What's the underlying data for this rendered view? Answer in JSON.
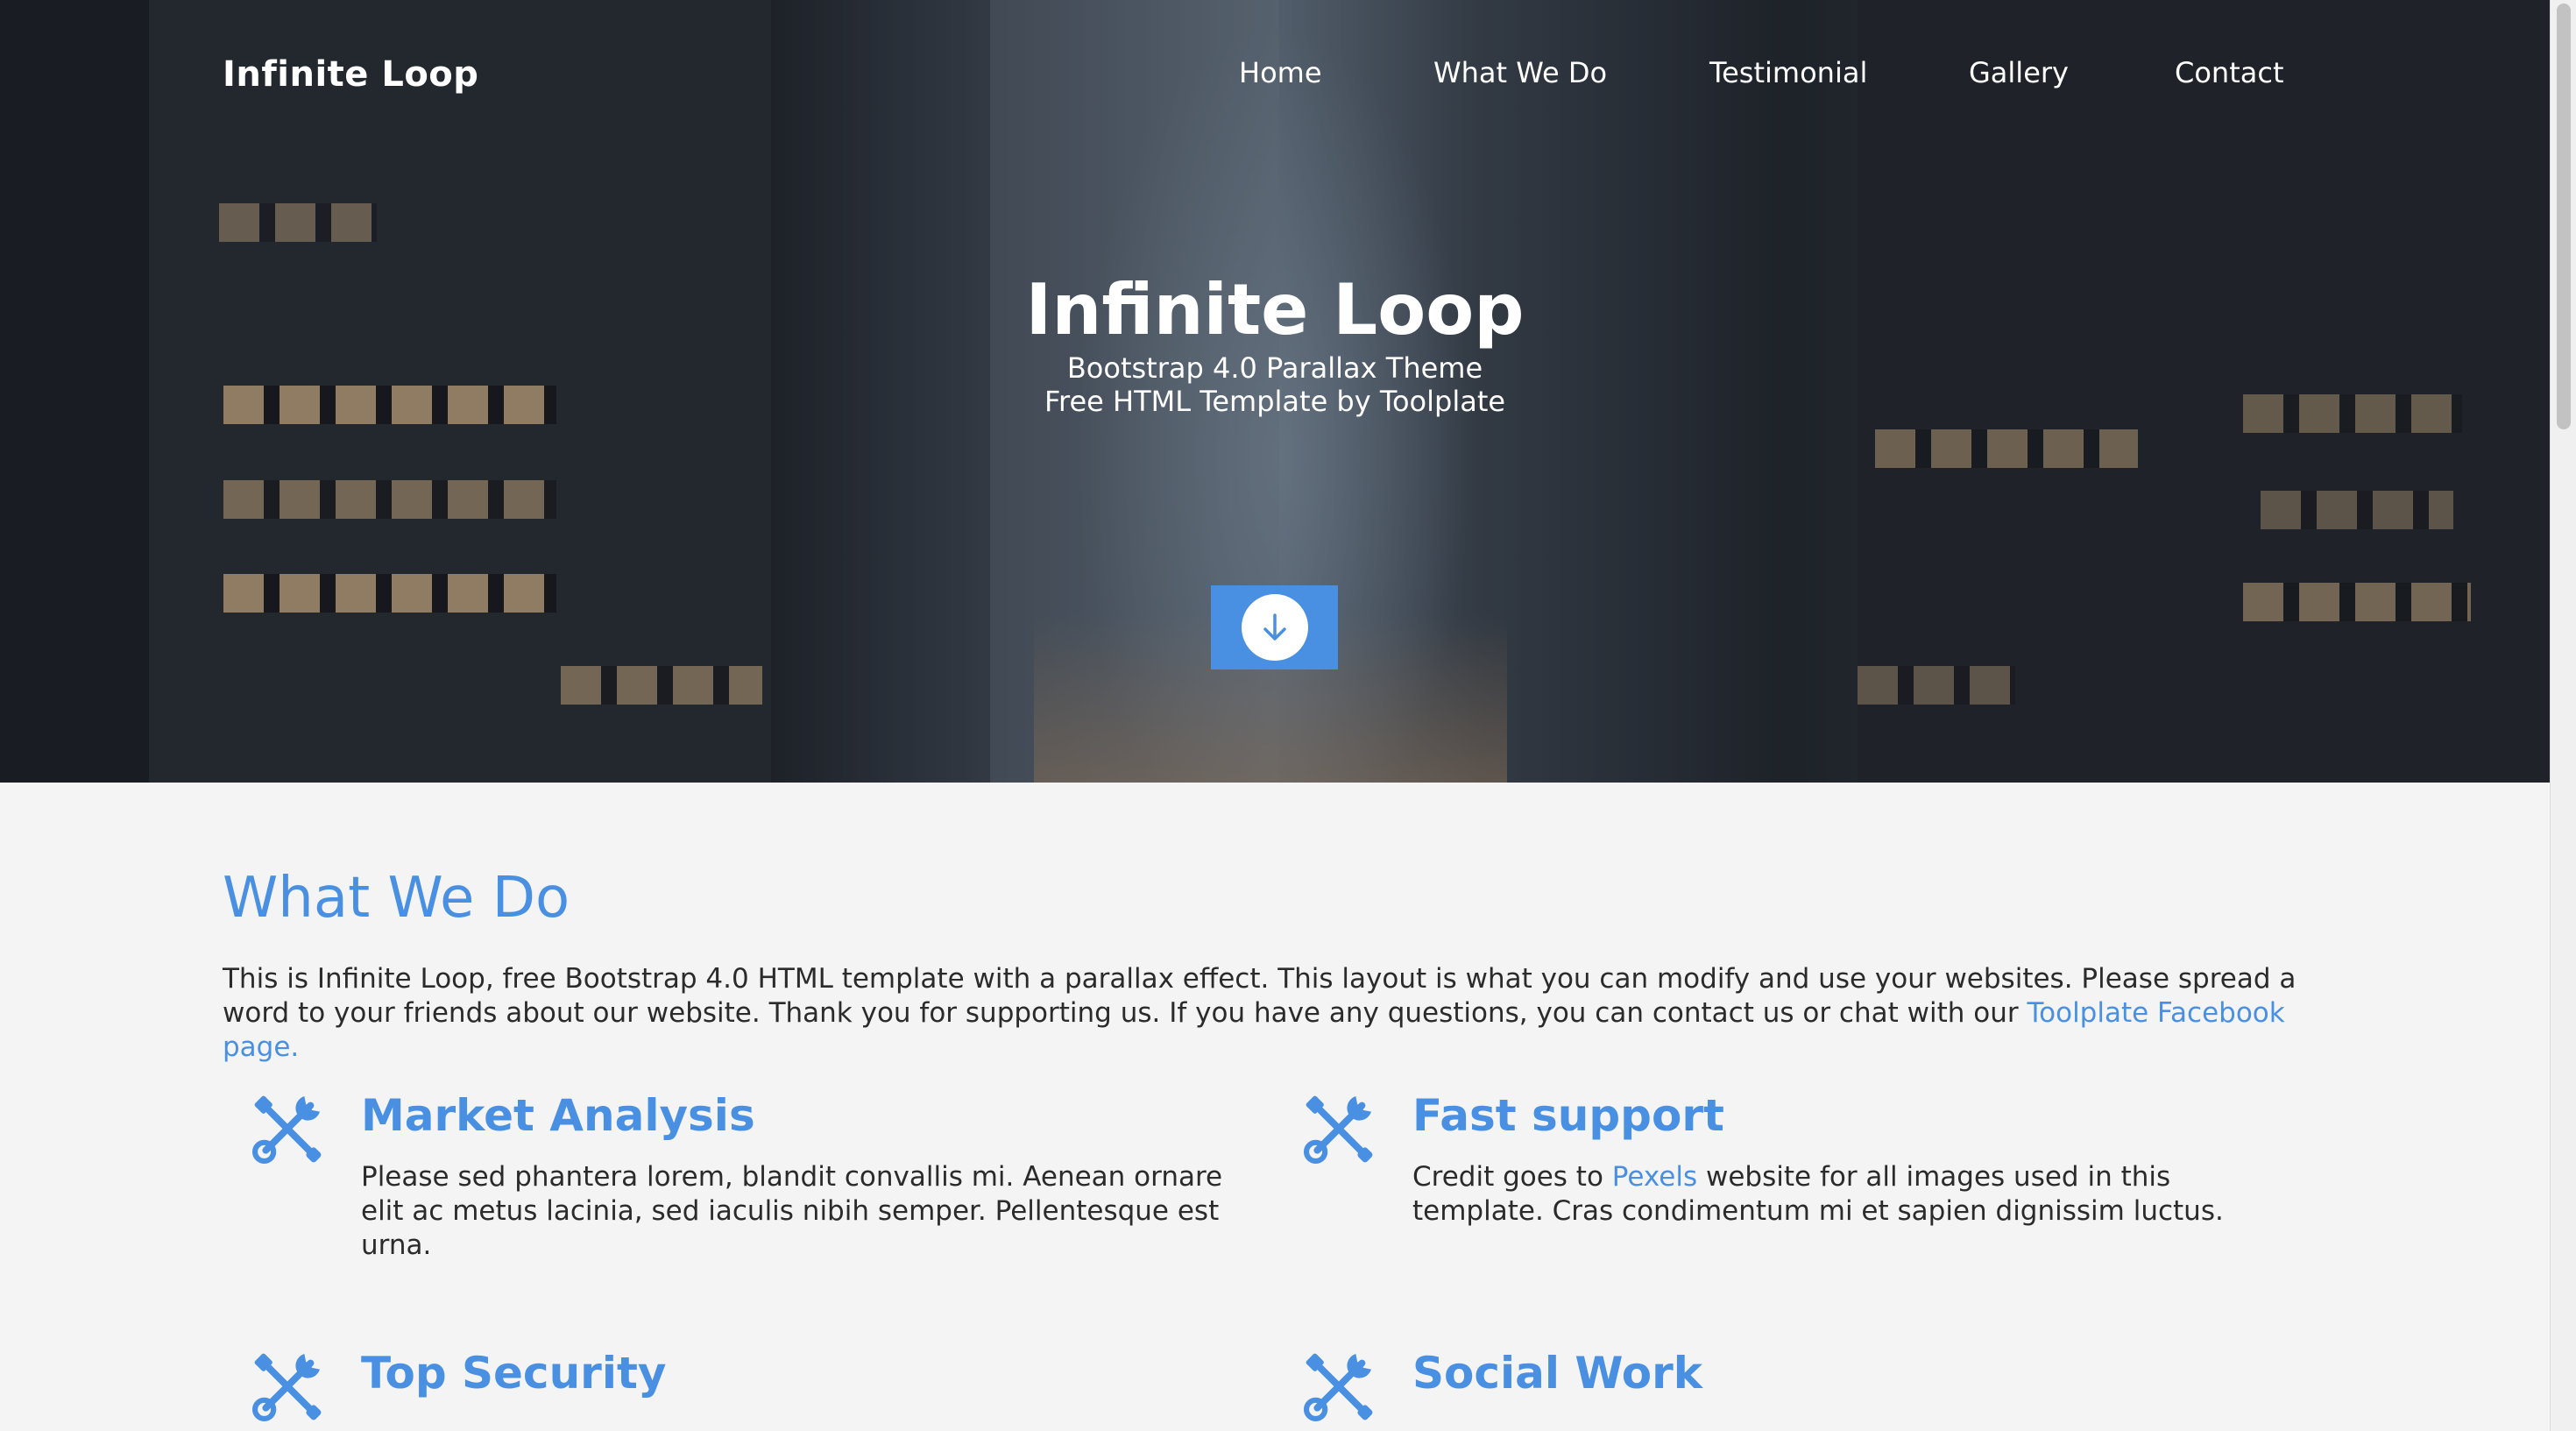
{
  "header": {
    "brand": "Infinite Loop",
    "nav": [
      "Home",
      "What We Do",
      "Testimonial",
      "Gallery",
      "Contact"
    ]
  },
  "hero": {
    "title": "Infinite Loop",
    "subtitle_line1": "Bootstrap 4.0 Parallax Theme",
    "subtitle_line2": "Free HTML Template by Toolplate",
    "scroll_icon": "arrow-down-icon"
  },
  "what_we_do": {
    "title": "What We Do",
    "intro_text": "This is Infinite Loop, free Bootstrap 4.0 HTML template with a parallax effect. This layout is what you can modify and use your websites. Please spread a word to your friends about our website. Thank you for supporting us. If you have any questions, you can contact us or chat with our ",
    "intro_link": "Toolplate Facebook page.",
    "features": [
      {
        "icon": "tools-icon",
        "title": "Market Analysis",
        "text": "Please sed phantera lorem, blandit convallis mi. Aenean ornare elit ac metus lacinia, sed iaculis nibih semper. Pellentesque est urna."
      },
      {
        "icon": "tools-icon",
        "title": "Fast support",
        "text_before": "Credit goes to ",
        "link": "Pexels",
        "text_after": " website for all images used in this template. Cras condimentum mi et sapien dignissim luctus."
      },
      {
        "icon": "tools-icon",
        "title": "Top Security"
      },
      {
        "icon": "tools-icon",
        "title": "Social Work"
      }
    ]
  },
  "colors": {
    "accent": "#4a90e2",
    "page_bg": "#f4f4f4",
    "text": "#2b2b2b"
  }
}
